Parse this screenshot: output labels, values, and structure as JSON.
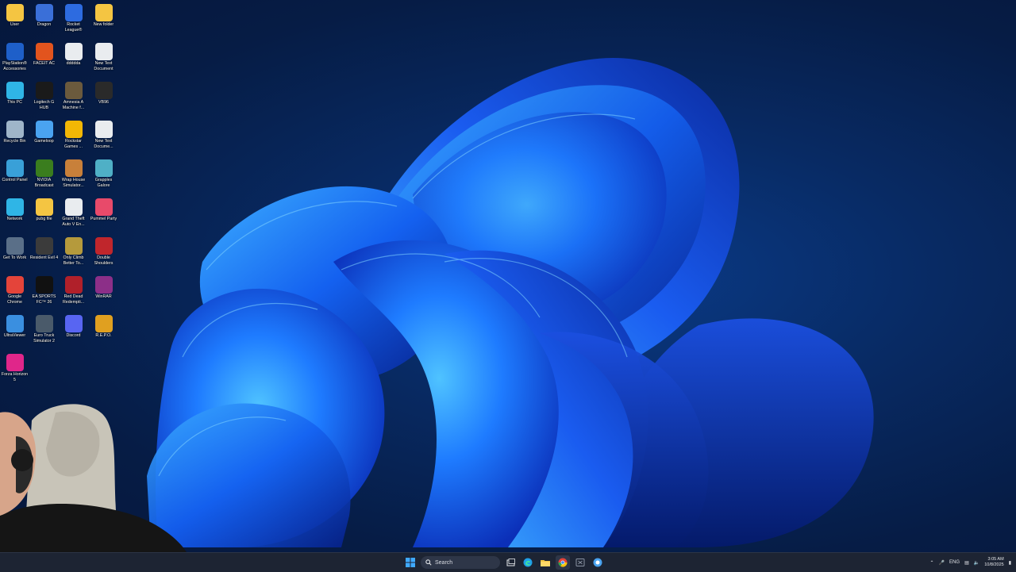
{
  "desktop": {
    "icons": [
      {
        "label": "User",
        "icon": "folder-icon",
        "color": "#f4c542"
      },
      {
        "label": "Dragon",
        "icon": "dragon-icon",
        "color": "#3a6fd8"
      },
      {
        "label": "Rocket League®",
        "icon": "rocket-league-icon",
        "color": "#2d6be0"
      },
      {
        "label": "New folder",
        "icon": "folder-icon",
        "color": "#f4c542"
      },
      {
        "label": "PlayStation® Accessories",
        "icon": "playstation-icon",
        "color": "#1e5fc9"
      },
      {
        "label": "FACEIT AC",
        "icon": "faceit-icon",
        "color": "#e2541e"
      },
      {
        "label": "ddddda",
        "icon": "text-file-icon",
        "color": "#e9ecef"
      },
      {
        "label": "New Text Document",
        "icon": "text-file-icon",
        "color": "#e9ecef"
      },
      {
        "label": "This PC",
        "icon": "computer-icon",
        "color": "#2fb5e6"
      },
      {
        "label": "Logitech G HUB",
        "icon": "logitech-icon",
        "color": "#1a1a1a"
      },
      {
        "label": "Amnesia A Machine f...",
        "icon": "amnesia-icon",
        "color": "#6b5a3d"
      },
      {
        "label": "VB96",
        "icon": "vb96-icon",
        "color": "#2a2a2a"
      },
      {
        "label": "Recycle Bin",
        "icon": "recycle-bin-icon",
        "color": "#9fb5c9"
      },
      {
        "label": "Gameloop",
        "icon": "gameloop-icon",
        "color": "#4aa3f0"
      },
      {
        "label": "Rockstar Games ...",
        "icon": "rockstar-icon",
        "color": "#f2b705"
      },
      {
        "label": "New Text Docume...",
        "icon": "text-file-icon",
        "color": "#e9ecef"
      },
      {
        "label": "Control Panel",
        "icon": "control-panel-icon",
        "color": "#39a0d8"
      },
      {
        "label": "NVIDIA Broadcast",
        "icon": "nvidia-icon",
        "color": "#3a7d1e"
      },
      {
        "label": "Wrap House Simulator...",
        "icon": "wrap-house-icon",
        "color": "#c8803a"
      },
      {
        "label": "Grapples Galore",
        "icon": "grapples-icon",
        "color": "#4fb0c6"
      },
      {
        "label": "Network",
        "icon": "network-icon",
        "color": "#2fb5e6"
      },
      {
        "label": "pubg file",
        "icon": "folder-icon",
        "color": "#f4c542"
      },
      {
        "label": "Grand Theft Auto V En...",
        "icon": "gta-icon",
        "color": "#e9ecef"
      },
      {
        "label": "Pummel Party",
        "icon": "pummel-party-icon",
        "color": "#e84a6a"
      },
      {
        "label": "Get To Work",
        "icon": "get-to-work-icon",
        "color": "#5a6f88"
      },
      {
        "label": "Resident Evil 4",
        "icon": "resident-evil-icon",
        "color": "#3b3b3b"
      },
      {
        "label": "Only Climb Better To...",
        "icon": "only-climb-icon",
        "color": "#b59a3c"
      },
      {
        "label": "Double Shoulders",
        "icon": "ds-icon",
        "color": "#c0262c"
      },
      {
        "label": "Google Chrome",
        "icon": "chrome-icon",
        "color": "#e4443a"
      },
      {
        "label": "EA SPORTS FC™ 26",
        "icon": "ea-fc-icon",
        "color": "#111111"
      },
      {
        "label": "Red Dead Redempti...",
        "icon": "red-dead-icon",
        "color": "#b0202a"
      },
      {
        "label": "WinRAR",
        "icon": "winrar-icon",
        "color": "#8c2f88"
      },
      {
        "label": "UltraViewer",
        "icon": "ultraviewer-icon",
        "color": "#3a8fe0"
      },
      {
        "label": "Euro Truck Simulator 2",
        "icon": "euro-truck-icon",
        "color": "#4a5a6a"
      },
      {
        "label": "Discord",
        "icon": "discord-icon",
        "color": "#5865f2"
      },
      {
        "label": "R.E.P.O.",
        "icon": "repo-icon",
        "color": "#e0a020"
      },
      {
        "label": "Forza Horizon 5",
        "icon": "forza-icon",
        "color": "#e0268a"
      }
    ]
  },
  "taskbar": {
    "search_placeholder": "Search",
    "language": "ENG",
    "time": "3:05 AM",
    "date": "10/8/2025"
  }
}
